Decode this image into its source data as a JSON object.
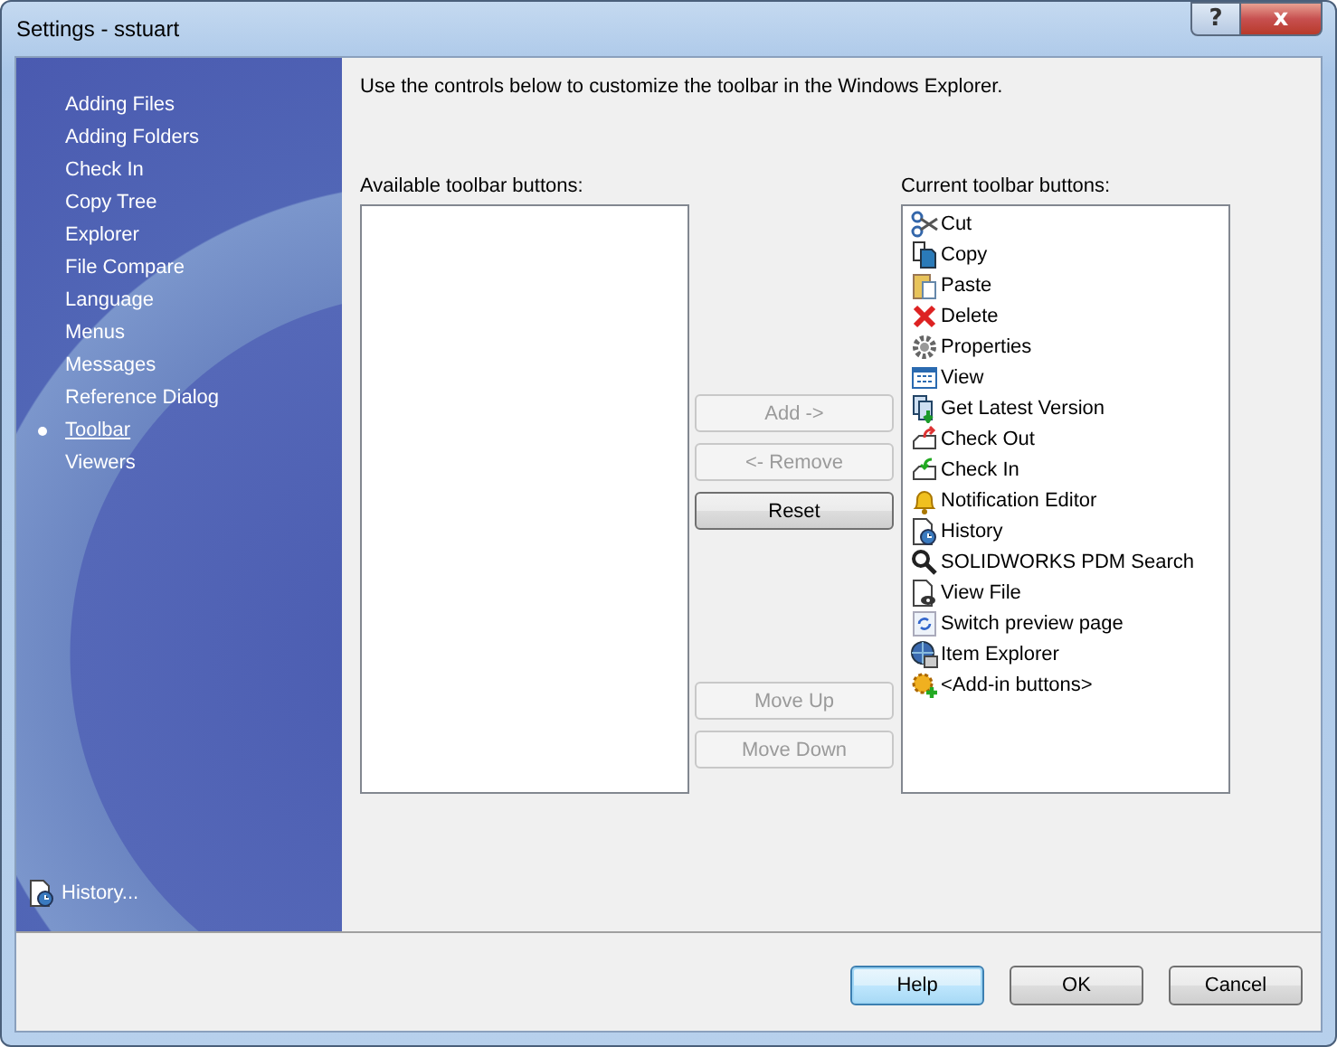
{
  "window": {
    "title": "Settings - sstuart",
    "help_glyph": "?",
    "close_glyph": "x"
  },
  "sidebar": {
    "items": [
      {
        "label": "Adding Files",
        "selected": false
      },
      {
        "label": "Adding Folders",
        "selected": false
      },
      {
        "label": "Check In",
        "selected": false
      },
      {
        "label": "Copy Tree",
        "selected": false
      },
      {
        "label": "Explorer",
        "selected": false
      },
      {
        "label": "File Compare",
        "selected": false
      },
      {
        "label": "Language",
        "selected": false
      },
      {
        "label": "Menus",
        "selected": false
      },
      {
        "label": "Messages",
        "selected": false
      },
      {
        "label": "Reference Dialog",
        "selected": false
      },
      {
        "label": "Toolbar",
        "selected": true
      },
      {
        "label": "Viewers",
        "selected": false
      }
    ],
    "history_link": "History..."
  },
  "description": "Use the controls below to customize the toolbar in the Windows Explorer.",
  "available": {
    "label": "Available toolbar buttons:"
  },
  "current": {
    "label": "Current toolbar buttons:",
    "items": [
      "Cut",
      "Copy",
      "Paste",
      "Delete",
      "Properties",
      "View",
      "Get Latest Version",
      "Check Out",
      "Check In",
      "Notification Editor",
      "History",
      "SOLIDWORKS PDM Search",
      "View File",
      "Switch preview page",
      "Item Explorer",
      "<Add-in buttons>"
    ]
  },
  "transfer_buttons": [
    {
      "label": "Add ->",
      "disabled": true
    },
    {
      "label": "<- Remove",
      "disabled": true
    },
    {
      "label": "Reset",
      "disabled": false
    }
  ],
  "order_buttons": [
    {
      "label": "Move Up",
      "disabled": true
    },
    {
      "label": "Move Down",
      "disabled": true
    }
  ],
  "footer_buttons": [
    {
      "label": "Help",
      "default": true
    },
    {
      "label": "OK",
      "default": false
    },
    {
      "label": "Cancel",
      "default": false
    }
  ]
}
